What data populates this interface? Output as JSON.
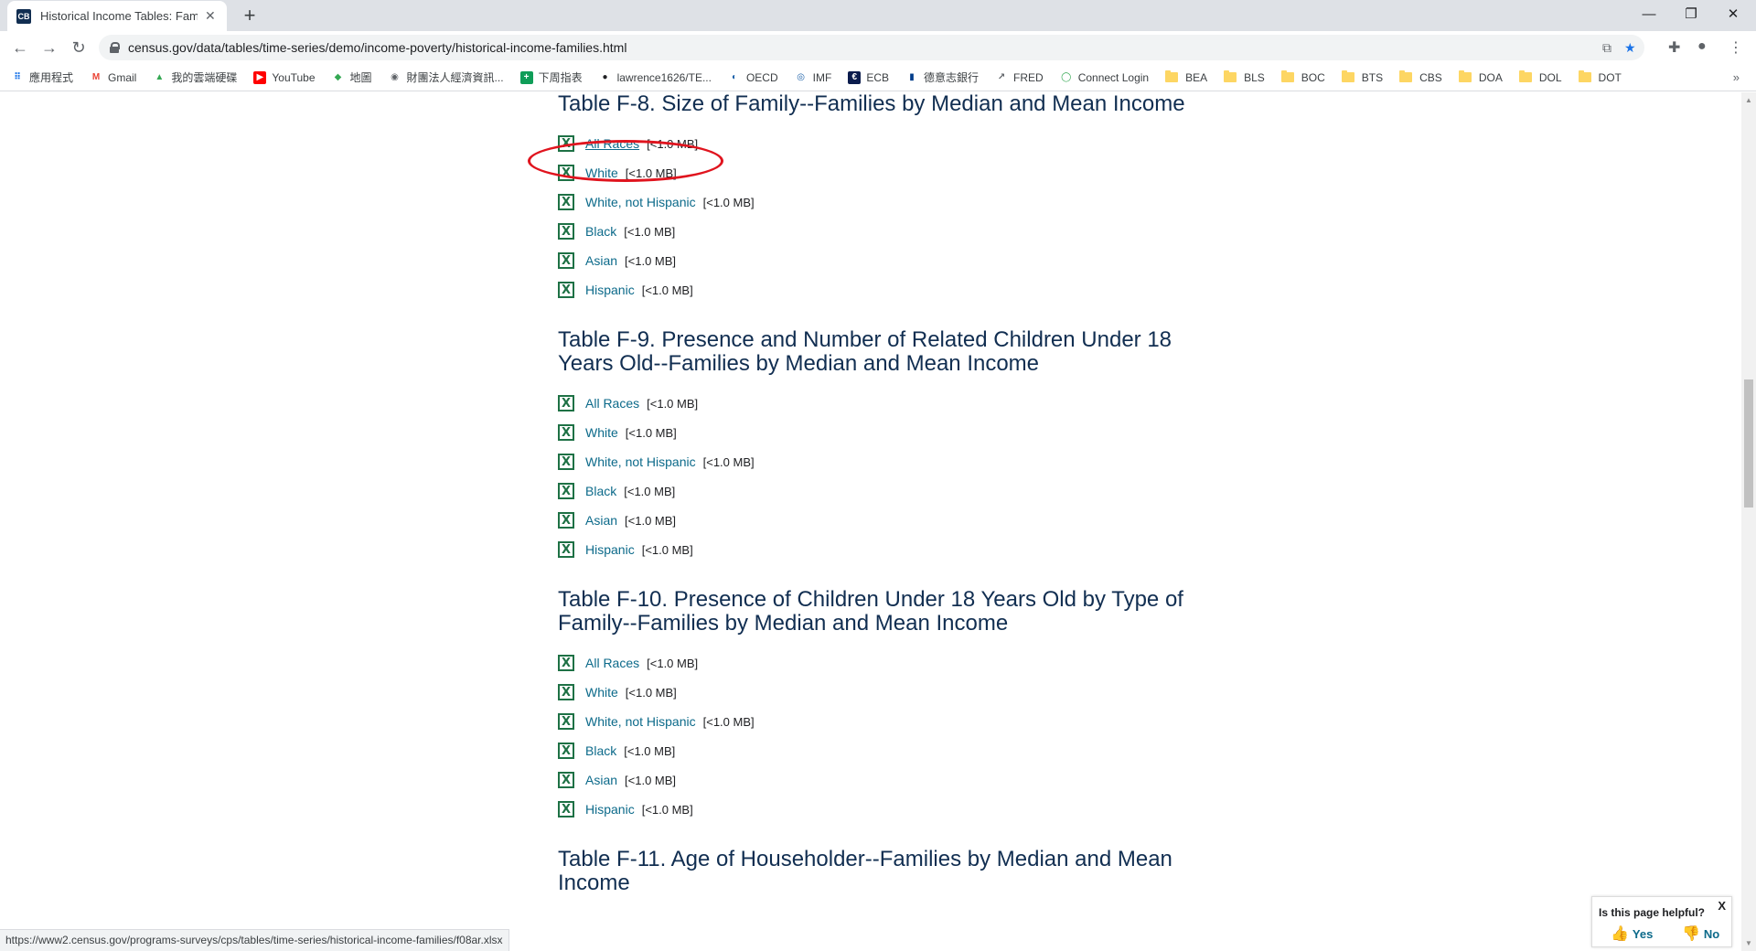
{
  "browser": {
    "tab_title": "Historical Income Tables: Families",
    "tab_favicon": "CB",
    "url": "census.gov/data/tables/time-series/demo/income-poverty/historical-income-families.html",
    "bookmarks": [
      {
        "label": "應用程式",
        "icon": "apps-icon"
      },
      {
        "label": "Gmail",
        "icon": "gmail-icon"
      },
      {
        "label": "我的雲端硬碟",
        "icon": "drive-icon"
      },
      {
        "label": "YouTube",
        "icon": "youtube-icon"
      },
      {
        "label": "地圖",
        "icon": "maps-icon"
      },
      {
        "label": "財團法人經濟資訊...",
        "icon": "globe-icon"
      },
      {
        "label": "下周指表",
        "icon": "plus-icon"
      },
      {
        "label": "lawrence1626/TE...",
        "icon": "github-icon"
      },
      {
        "label": "OECD",
        "icon": "oecd-icon"
      },
      {
        "label": "IMF",
        "icon": "imf-icon"
      },
      {
        "label": "ECB",
        "icon": "ecb-icon"
      },
      {
        "label": "德意志銀行",
        "icon": "bank-icon"
      },
      {
        "label": "FRED",
        "icon": "chart-icon"
      },
      {
        "label": "Connect Login",
        "icon": "connect-icon"
      },
      {
        "label": "BEA",
        "icon": "folder-icon"
      },
      {
        "label": "BLS",
        "icon": "folder-icon"
      },
      {
        "label": "BOC",
        "icon": "folder-icon"
      },
      {
        "label": "BTS",
        "icon": "folder-icon"
      },
      {
        "label": "CBS",
        "icon": "folder-icon"
      },
      {
        "label": "DOA",
        "icon": "folder-icon"
      },
      {
        "label": "DOL",
        "icon": "folder-icon"
      },
      {
        "label": "DOT",
        "icon": "folder-icon"
      }
    ],
    "bookmarks_more": "»"
  },
  "page": {
    "sections": [
      {
        "title": "Table F-8. Size of Family--Families by Median and Mean Income",
        "items": [
          {
            "label": "All Races",
            "size": "[<1.0 MB]"
          },
          {
            "label": "White",
            "size": "[<1.0 MB]"
          },
          {
            "label": "White, not Hispanic",
            "size": "[<1.0 MB]"
          },
          {
            "label": "Black",
            "size": "[<1.0 MB]"
          },
          {
            "label": "Asian",
            "size": "[<1.0 MB]"
          },
          {
            "label": "Hispanic",
            "size": "[<1.0 MB]"
          }
        ]
      },
      {
        "title": "Table F-9. Presence and Number of Related Children Under 18 Years Old--Families by Median and Mean Income",
        "items": [
          {
            "label": "All Races",
            "size": "[<1.0 MB]"
          },
          {
            "label": "White",
            "size": "[<1.0 MB]"
          },
          {
            "label": "White, not Hispanic",
            "size": "[<1.0 MB]"
          },
          {
            "label": "Black",
            "size": "[<1.0 MB]"
          },
          {
            "label": "Asian",
            "size": "[<1.0 MB]"
          },
          {
            "label": "Hispanic",
            "size": "[<1.0 MB]"
          }
        ]
      },
      {
        "title": "Table F-10. Presence of Children Under 18 Years Old by Type of Family--Families by Median and Mean Income",
        "items": [
          {
            "label": "All Races",
            "size": "[<1.0 MB]"
          },
          {
            "label": "White",
            "size": "[<1.0 MB]"
          },
          {
            "label": "White, not Hispanic",
            "size": "[<1.0 MB]"
          },
          {
            "label": "Black",
            "size": "[<1.0 MB]"
          },
          {
            "label": "Asian",
            "size": "[<1.0 MB]"
          },
          {
            "label": "Hispanic",
            "size": "[<1.0 MB]"
          }
        ]
      },
      {
        "title": "Table F-11. Age of Householder--Families by Median and Mean Income",
        "items": []
      }
    ],
    "highlighted_link": "All Races"
  },
  "status_bar": "https://www2.census.gov/programs-surveys/cps/tables/time-series/historical-income-families/f08ar.xlsx",
  "feedback": {
    "question": "Is this page helpful?",
    "yes": "Yes",
    "no": "No",
    "close": "X"
  },
  "colors": {
    "link": "#0c6a8a",
    "heading": "#112e51",
    "excel_icon": "#1e7145",
    "annotation": "#e0141e"
  }
}
